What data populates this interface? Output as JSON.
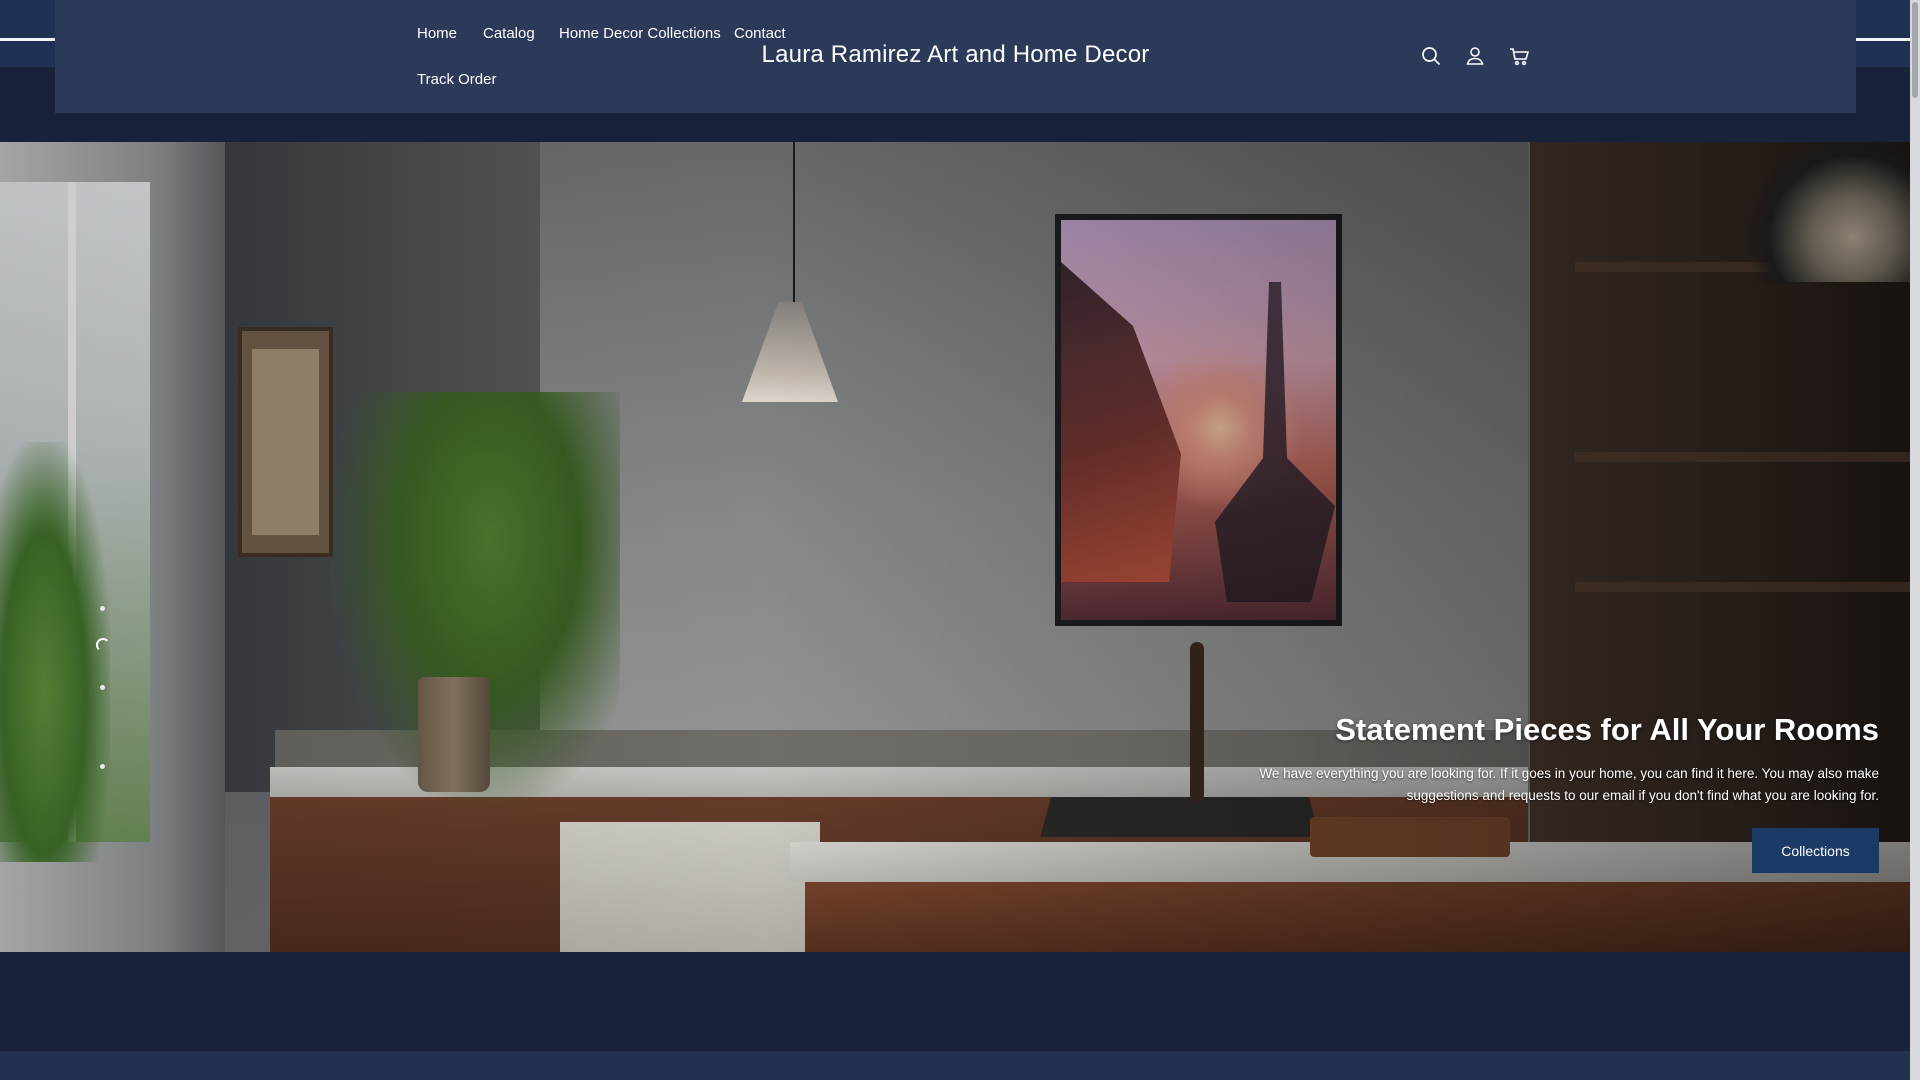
{
  "header": {
    "site_title": "Laura Ramirez Art and Home Decor",
    "nav": [
      {
        "label": "Home"
      },
      {
        "label": "Catalog"
      },
      {
        "label": "Home Decor Collections"
      },
      {
        "label": "Contact"
      },
      {
        "label": "Track Order"
      }
    ],
    "icons": [
      "search-icon",
      "account-icon",
      "cart-icon"
    ]
  },
  "hero": {
    "heading": "Statement Pieces for All Your Rooms",
    "subtext_line1": "We have everything you are looking for. If it goes in your home, you can find it here. You may also make",
    "subtext_line2": "suggestions and requests to our email if you don't find what you are looking for.",
    "button_label": "Collections",
    "slide_count": 4,
    "active_slide": 2
  },
  "colors": {
    "page_background": "#18223a",
    "header_background": "#2a3a58",
    "button_background": "#1c3a66",
    "text": "#ffffff"
  }
}
